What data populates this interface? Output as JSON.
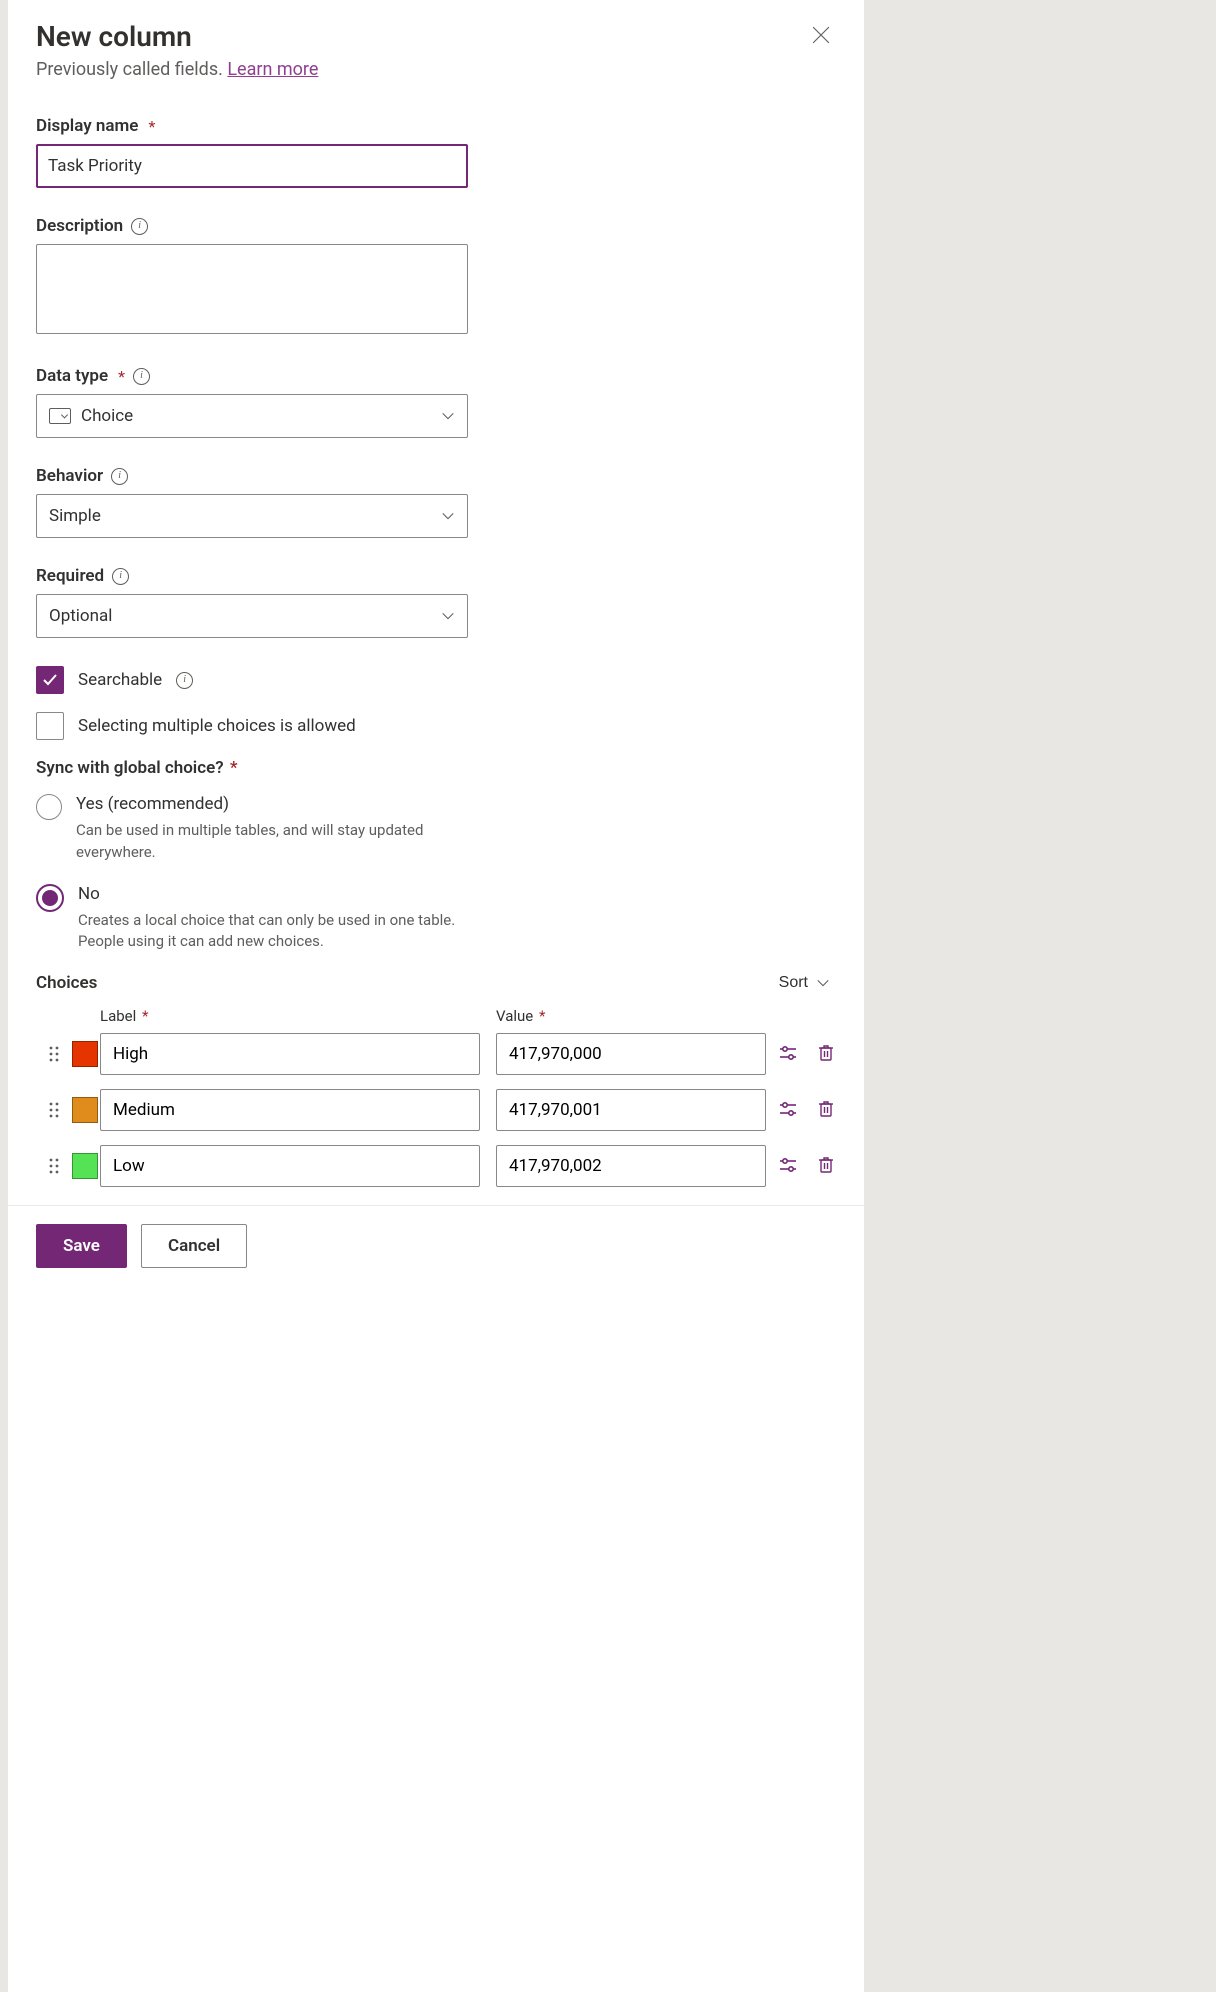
{
  "header": {
    "title": "New column",
    "subtitle_prefix": "Previously called fields. ",
    "learn_more": "Learn more"
  },
  "fields": {
    "display_name": {
      "label": "Display name",
      "value": "Task Priority"
    },
    "description": {
      "label": "Description",
      "value": ""
    },
    "data_type": {
      "label": "Data type",
      "value": "Choice"
    },
    "behavior": {
      "label": "Behavior",
      "value": "Simple"
    },
    "required": {
      "label": "Required",
      "value": "Optional"
    }
  },
  "checks": {
    "searchable": {
      "label": "Searchable",
      "checked": true
    },
    "multi": {
      "label": "Selecting multiple choices is allowed",
      "checked": false
    }
  },
  "sync": {
    "label": "Sync with global choice?",
    "yes": {
      "label": "Yes (recommended)",
      "desc": "Can be used in multiple tables, and will stay updated everywhere."
    },
    "no": {
      "label": "No",
      "desc": "Creates a local choice that can only be used in one table. People using it can add new choices."
    },
    "selected": "no"
  },
  "choices": {
    "title": "Choices",
    "sort_label": "Sort",
    "columns": {
      "label": "Label",
      "value": "Value"
    },
    "rows": [
      {
        "color": "#e53400",
        "label": "High",
        "value": "417,970,000"
      },
      {
        "color": "#e08c1c",
        "label": "Medium",
        "value": "417,970,001"
      },
      {
        "color": "#55e255",
        "label": "Low",
        "value": "417,970,002"
      }
    ]
  },
  "footer": {
    "save": "Save",
    "cancel": "Cancel"
  }
}
